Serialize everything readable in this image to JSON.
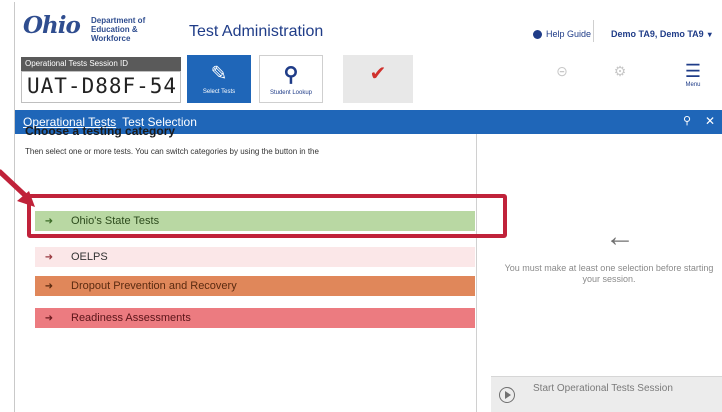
{
  "header": {
    "logo_text": "Ohio",
    "logo_dept_lines": [
      "Department of",
      "Education &",
      "Workforce"
    ],
    "app_title": "Test Administration",
    "help_label": "Help Guide",
    "user_label": "Demo TA9, Demo TA9"
  },
  "session": {
    "label": "Operational Tests Session ID",
    "id": "UAT-D88F-54"
  },
  "toolbar": {
    "select_tests_label": "Select Tests",
    "student_lookup_label": "Student Lookup",
    "red_button_label": "",
    "gray1_label": "",
    "gray2_label": "",
    "menu_label": "Menu"
  },
  "breadcrumb": {
    "link": "Operational Tests",
    "current": "Test Selection"
  },
  "main": {
    "title": "Choose a testing category",
    "subtitle": "Then select one or more tests. You can switch categories by using the button in the",
    "categories": [
      {
        "label": "Ohio's State Tests"
      },
      {
        "label": "OELPS"
      },
      {
        "label": "Dropout Prevention and Recovery"
      },
      {
        "label": "Readiness Assessments"
      }
    ]
  },
  "right_panel": {
    "message": "You must make at least one selection before starting your session.",
    "start_button": "Start Operational Tests Session"
  },
  "colors": {
    "primary_blue": "#1f66b8",
    "ohio_green": "#b9d8a3",
    "dropout_orange": "#e0875a",
    "readiness_red": "#ec7b80",
    "highlight_red": "#c0223a"
  }
}
